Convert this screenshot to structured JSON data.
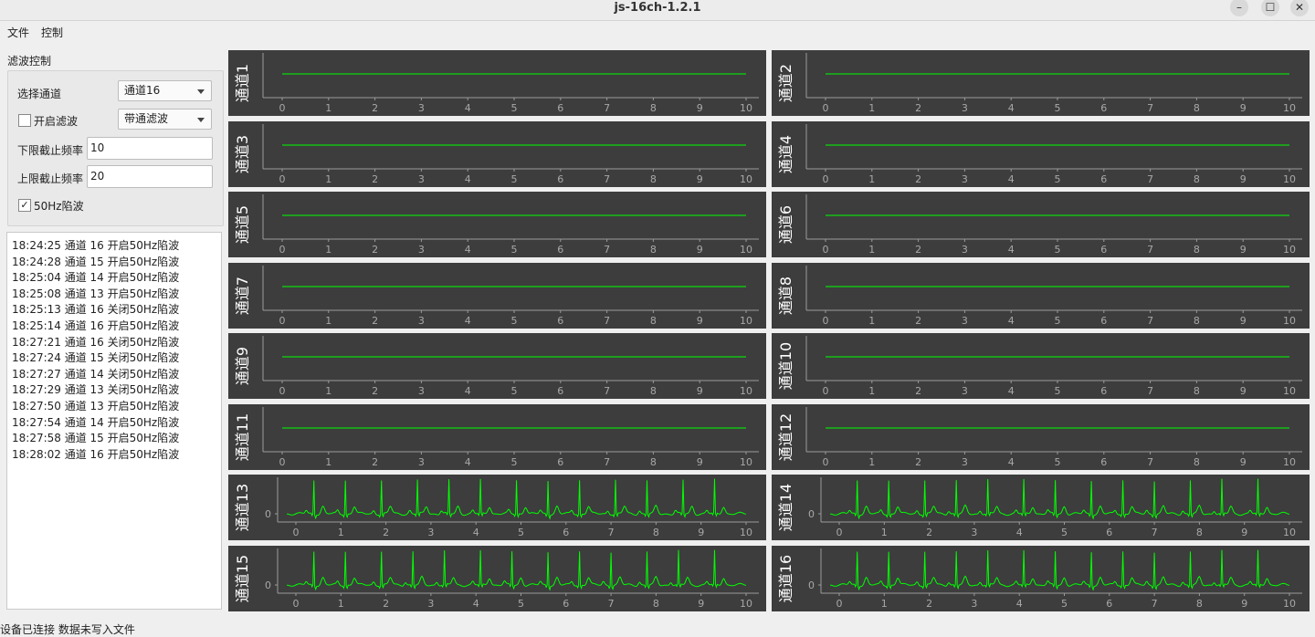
{
  "window": {
    "title": "js-16ch-1.2.1",
    "minimize": "–",
    "maximize": "☐",
    "close": "✕"
  },
  "menu": {
    "file": "文件",
    "control": "控制"
  },
  "filter": {
    "group_title": "滤波控制",
    "select_channel_label": "选择通道",
    "select_channel_value": "通道16",
    "enable_filter_label": "开启滤波",
    "enable_filter_checked": false,
    "filter_type_value": "带通滤波",
    "low_cutoff_label": "下限截止频率",
    "low_cutoff_value": "10",
    "high_cutoff_label": "上限截止频率",
    "high_cutoff_value": "20",
    "notch_label": "50Hz陷波",
    "notch_checked": true
  },
  "log": [
    "18:24:25 通道 16 开启50Hz陷波",
    "18:24:28 通道 15 开启50Hz陷波",
    "18:25:04 通道 14 开启50Hz陷波",
    "18:25:08 通道 13 开启50Hz陷波",
    "18:25:13 通道 16 关闭50Hz陷波",
    "18:25:14 通道 16 开启50Hz陷波",
    "18:27:21 通道 16 关闭50Hz陷波",
    "18:27:24 通道 15 关闭50Hz陷波",
    "18:27:27 通道 14 关闭50Hz陷波",
    "18:27:29 通道 13 关闭50Hz陷波",
    "18:27:50 通道 13 开启50Hz陷波",
    "18:27:54 通道 14 开启50Hz陷波",
    "18:27:58 通道 15 开启50Hz陷波",
    "18:28:02 通道 16 开启50Hz陷波"
  ],
  "status": "设备已连接  数据未写入文件",
  "colors": {
    "plot_bg": "#3d3d3d",
    "trace": "#00ff00",
    "axis": "#9a9a9a",
    "tick_text": "#a8a8a8"
  },
  "chart_data": [
    {
      "type": "line",
      "ylabel": "通道1",
      "x_ticks": [
        0,
        1,
        2,
        3,
        4,
        5,
        6,
        7,
        8,
        9,
        10
      ],
      "xlim": [
        0,
        10
      ],
      "signal": "flat"
    },
    {
      "type": "line",
      "ylabel": "通道2",
      "x_ticks": [
        0,
        1,
        2,
        3,
        4,
        5,
        6,
        7,
        8,
        9,
        10
      ],
      "xlim": [
        0,
        10
      ],
      "signal": "flat"
    },
    {
      "type": "line",
      "ylabel": "通道3",
      "x_ticks": [
        0,
        1,
        2,
        3,
        4,
        5,
        6,
        7,
        8,
        9,
        10
      ],
      "xlim": [
        0,
        10
      ],
      "signal": "flat"
    },
    {
      "type": "line",
      "ylabel": "通道4",
      "x_ticks": [
        0,
        1,
        2,
        3,
        4,
        5,
        6,
        7,
        8,
        9,
        10
      ],
      "xlim": [
        0,
        10
      ],
      "signal": "flat"
    },
    {
      "type": "line",
      "ylabel": "通道5",
      "x_ticks": [
        0,
        1,
        2,
        3,
        4,
        5,
        6,
        7,
        8,
        9,
        10
      ],
      "xlim": [
        0,
        10
      ],
      "signal": "flat"
    },
    {
      "type": "line",
      "ylabel": "通道6",
      "x_ticks": [
        0,
        1,
        2,
        3,
        4,
        5,
        6,
        7,
        8,
        9,
        10
      ],
      "xlim": [
        0,
        10
      ],
      "signal": "flat"
    },
    {
      "type": "line",
      "ylabel": "通道7",
      "x_ticks": [
        0,
        1,
        2,
        3,
        4,
        5,
        6,
        7,
        8,
        9,
        10
      ],
      "xlim": [
        0,
        10
      ],
      "signal": "flat"
    },
    {
      "type": "line",
      "ylabel": "通道8",
      "x_ticks": [
        0,
        1,
        2,
        3,
        4,
        5,
        6,
        7,
        8,
        9,
        10
      ],
      "xlim": [
        0,
        10
      ],
      "signal": "flat"
    },
    {
      "type": "line",
      "ylabel": "通道9",
      "x_ticks": [
        0,
        1,
        2,
        3,
        4,
        5,
        6,
        7,
        8,
        9,
        10
      ],
      "xlim": [
        0,
        10
      ],
      "signal": "flat"
    },
    {
      "type": "line",
      "ylabel": "通道10",
      "x_ticks": [
        0,
        1,
        2,
        3,
        4,
        5,
        6,
        7,
        8,
        9,
        10
      ],
      "xlim": [
        0,
        10
      ],
      "signal": "flat"
    },
    {
      "type": "line",
      "ylabel": "通道11",
      "x_ticks": [
        0,
        1,
        2,
        3,
        4,
        5,
        6,
        7,
        8,
        9,
        10
      ],
      "xlim": [
        0,
        10
      ],
      "signal": "flat"
    },
    {
      "type": "line",
      "ylabel": "通道12",
      "x_ticks": [
        0,
        1,
        2,
        3,
        4,
        5,
        6,
        7,
        8,
        9,
        10
      ],
      "xlim": [
        0,
        10
      ],
      "signal": "flat"
    },
    {
      "type": "line",
      "ylabel": "通道13",
      "x_ticks": [
        0,
        1,
        2,
        3,
        4,
        5,
        6,
        7,
        8,
        9,
        10
      ],
      "xlim": [
        0,
        10
      ],
      "y_ticks": [
        0
      ],
      "signal": "ecg",
      "beat_times": [
        0.4,
        1.1,
        1.9,
        2.7,
        3.4,
        4.1,
        4.9,
        5.6,
        6.3,
        7.1,
        7.8,
        8.6,
        9.3
      ]
    },
    {
      "type": "line",
      "ylabel": "通道14",
      "x_ticks": [
        0,
        1,
        2,
        3,
        4,
        5,
        6,
        7,
        8,
        9,
        10
      ],
      "xlim": [
        0,
        10
      ],
      "y_ticks": [
        0
      ],
      "signal": "ecg",
      "beat_times": [
        0.4,
        1.1,
        1.9,
        2.6,
        3.3,
        4.1,
        4.8,
        5.6,
        6.3,
        7.0,
        7.8,
        8.5,
        9.3
      ]
    },
    {
      "type": "line",
      "ylabel": "通道15",
      "x_ticks": [
        0,
        1,
        2,
        3,
        4,
        5,
        6,
        7,
        8,
        9,
        10
      ],
      "xlim": [
        0,
        10
      ],
      "y_ticks": [
        0
      ],
      "signal": "ecg",
      "beat_times": [
        0.4,
        1.1,
        1.9,
        2.6,
        3.3,
        4.1,
        4.8,
        5.6,
        6.3,
        7.0,
        7.8,
        8.5,
        9.3
      ]
    },
    {
      "type": "line",
      "ylabel": "通道16",
      "x_ticks": [
        0,
        1,
        2,
        3,
        4,
        5,
        6,
        7,
        8,
        9,
        10
      ],
      "xlim": [
        0,
        10
      ],
      "y_ticks": [
        0
      ],
      "signal": "ecg",
      "beat_times": [
        0.4,
        1.1,
        1.9,
        2.6,
        3.3,
        4.1,
        4.8,
        5.6,
        6.3,
        7.0,
        7.8,
        8.5,
        9.3
      ]
    }
  ]
}
